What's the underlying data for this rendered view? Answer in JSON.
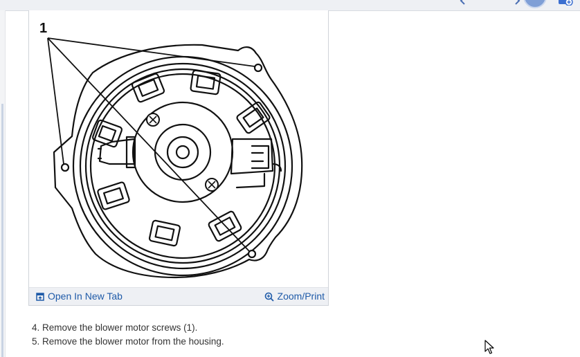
{
  "figure": {
    "callout_label": "1",
    "open_tab_label": "Open In New Tab",
    "zoom_label": "Zoom/Print",
    "open_tab_icon": "open-new-tab-icon",
    "zoom_icon": "magnifier-plus-icon"
  },
  "steps": [
    "4. Remove the blower motor screws (1).",
    "5. Remove the blower motor from the housing."
  ],
  "colors": {
    "link": "#1e5aa8",
    "footer_bg": "#eef0f4",
    "text": "#333333",
    "avatar": "#7f9fd6"
  }
}
